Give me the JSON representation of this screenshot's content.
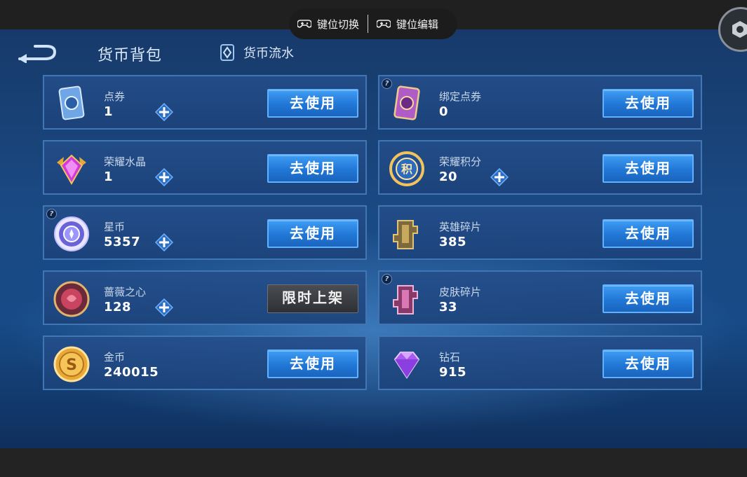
{
  "overlay": {
    "switch_label": "键位切换",
    "edit_label": "键位编辑"
  },
  "header": {
    "title": "货币背包",
    "flow_label": "货币流水"
  },
  "cards": [
    {
      "label": "点券",
      "value": "1",
      "has_plus": true,
      "has_help": false,
      "button": "去使用",
      "icon": "voucher-card-icon"
    },
    {
      "label": "绑定点券",
      "value": "0",
      "has_plus": false,
      "has_help": true,
      "button": "去使用",
      "icon": "bound-voucher-card-icon"
    },
    {
      "label": "荣耀水晶",
      "value": "1",
      "has_plus": true,
      "has_help": false,
      "button": "去使用",
      "icon": "glory-crystal-icon"
    },
    {
      "label": "荣耀积分",
      "value": "20",
      "has_plus": true,
      "has_help": false,
      "button": "去使用",
      "icon": "glory-points-icon",
      "icon_text": "积"
    },
    {
      "label": "星币",
      "value": "5357",
      "has_plus": true,
      "has_help": true,
      "button": "去使用",
      "icon": "star-coin-icon"
    },
    {
      "label": "英雄碎片",
      "value": "385",
      "has_plus": false,
      "has_help": false,
      "button": "去使用",
      "icon": "hero-fragment-icon"
    },
    {
      "label": "蔷薇之心",
      "value": "128",
      "has_plus": true,
      "has_help": false,
      "button": "限时上架",
      "icon": "rose-heart-icon"
    },
    {
      "label": "皮肤碎片",
      "value": "33",
      "has_plus": false,
      "has_help": true,
      "button": "去使用",
      "icon": "skin-fragment-icon"
    },
    {
      "label": "金币",
      "value": "240015",
      "has_plus": false,
      "has_help": false,
      "button": "去使用",
      "icon": "gold-coin-icon",
      "icon_text": "S"
    },
    {
      "label": "钻石",
      "value": "915",
      "has_plus": false,
      "has_help": false,
      "button": "去使用",
      "icon": "diamond-icon"
    }
  ],
  "colors": {
    "accent": "#2a84e0",
    "card_border": "#3f76b3",
    "background": "#1a4a84"
  }
}
